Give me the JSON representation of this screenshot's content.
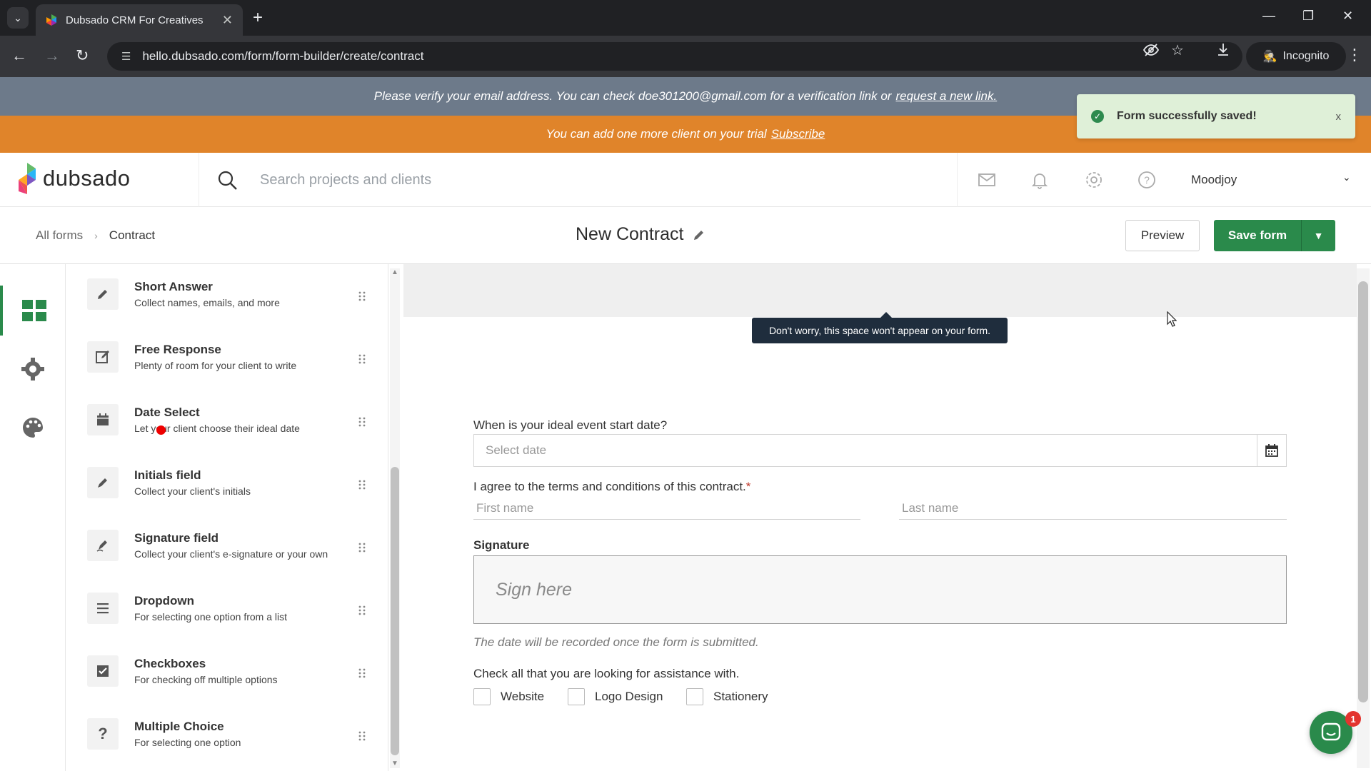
{
  "browser": {
    "tab_title": "Dubsado CRM For Creatives",
    "url": "hello.dubsado.com/form/form-builder/create/contract",
    "incognito_label": "Incognito"
  },
  "banners": {
    "verify_text": "Please verify your email address. You can check doe301200@gmail.com for a verification link or",
    "verify_link": "request a new link.",
    "trial_text": "You can add one more client on your trial",
    "trial_link": "Subscribe"
  },
  "toast": {
    "message": "Form successfully saved!",
    "close_label": "x"
  },
  "header": {
    "logo_text": "dubsado",
    "search_placeholder": "Search projects and clients",
    "user_name": "Moodjoy"
  },
  "subheader": {
    "breadcrumb_root": "All forms",
    "breadcrumb_current": "Contract",
    "form_title": "New Contract",
    "preview_label": "Preview",
    "save_label": "Save form"
  },
  "palette": {
    "items": [
      {
        "name": "Short Answer",
        "desc": "Collect names, emails, and more",
        "icon": "pencil-icon"
      },
      {
        "name": "Free Response",
        "desc": "Plenty of room for your client to write",
        "icon": "edit-square-icon"
      },
      {
        "name": "Date Select",
        "desc": "Let your client choose their ideal date",
        "icon": "calendar-icon"
      },
      {
        "name": "Initials field",
        "desc": "Collect your client's initials",
        "icon": "pen-icon"
      },
      {
        "name": "Signature field",
        "desc": "Collect your client's e-signature or your own",
        "icon": "signature-icon"
      },
      {
        "name": "Dropdown",
        "desc": "For selecting one option from a list",
        "icon": "list-icon"
      },
      {
        "name": "Checkboxes",
        "desc": "For checking off multiple options",
        "icon": "checkbox-icon"
      },
      {
        "name": "Multiple Choice",
        "desc": "For selecting one option",
        "icon": "question-icon"
      }
    ]
  },
  "canvas": {
    "tooltip": "Don't worry, this space won't appear on your form.",
    "date_question": "When is your ideal event start date?",
    "date_placeholder": "Select date",
    "agree_label": "I agree to the terms and conditions of this contract.",
    "required_mark": "*",
    "first_name_placeholder": "First name",
    "last_name_placeholder": "Last name",
    "signature_label": "Signature",
    "sign_here": "Sign here",
    "signature_note": "The date will be recorded once the form is submitted.",
    "checkbox_question": "Check all that you are looking for assistance with.",
    "checkbox_options": [
      "Website",
      "Logo Design",
      "Stationery"
    ]
  },
  "chat": {
    "badge_count": "1"
  },
  "colors": {
    "brand_green": "#2a8a4b",
    "trial_orange": "#e0842a",
    "verify_gray": "#6d7a8a"
  }
}
